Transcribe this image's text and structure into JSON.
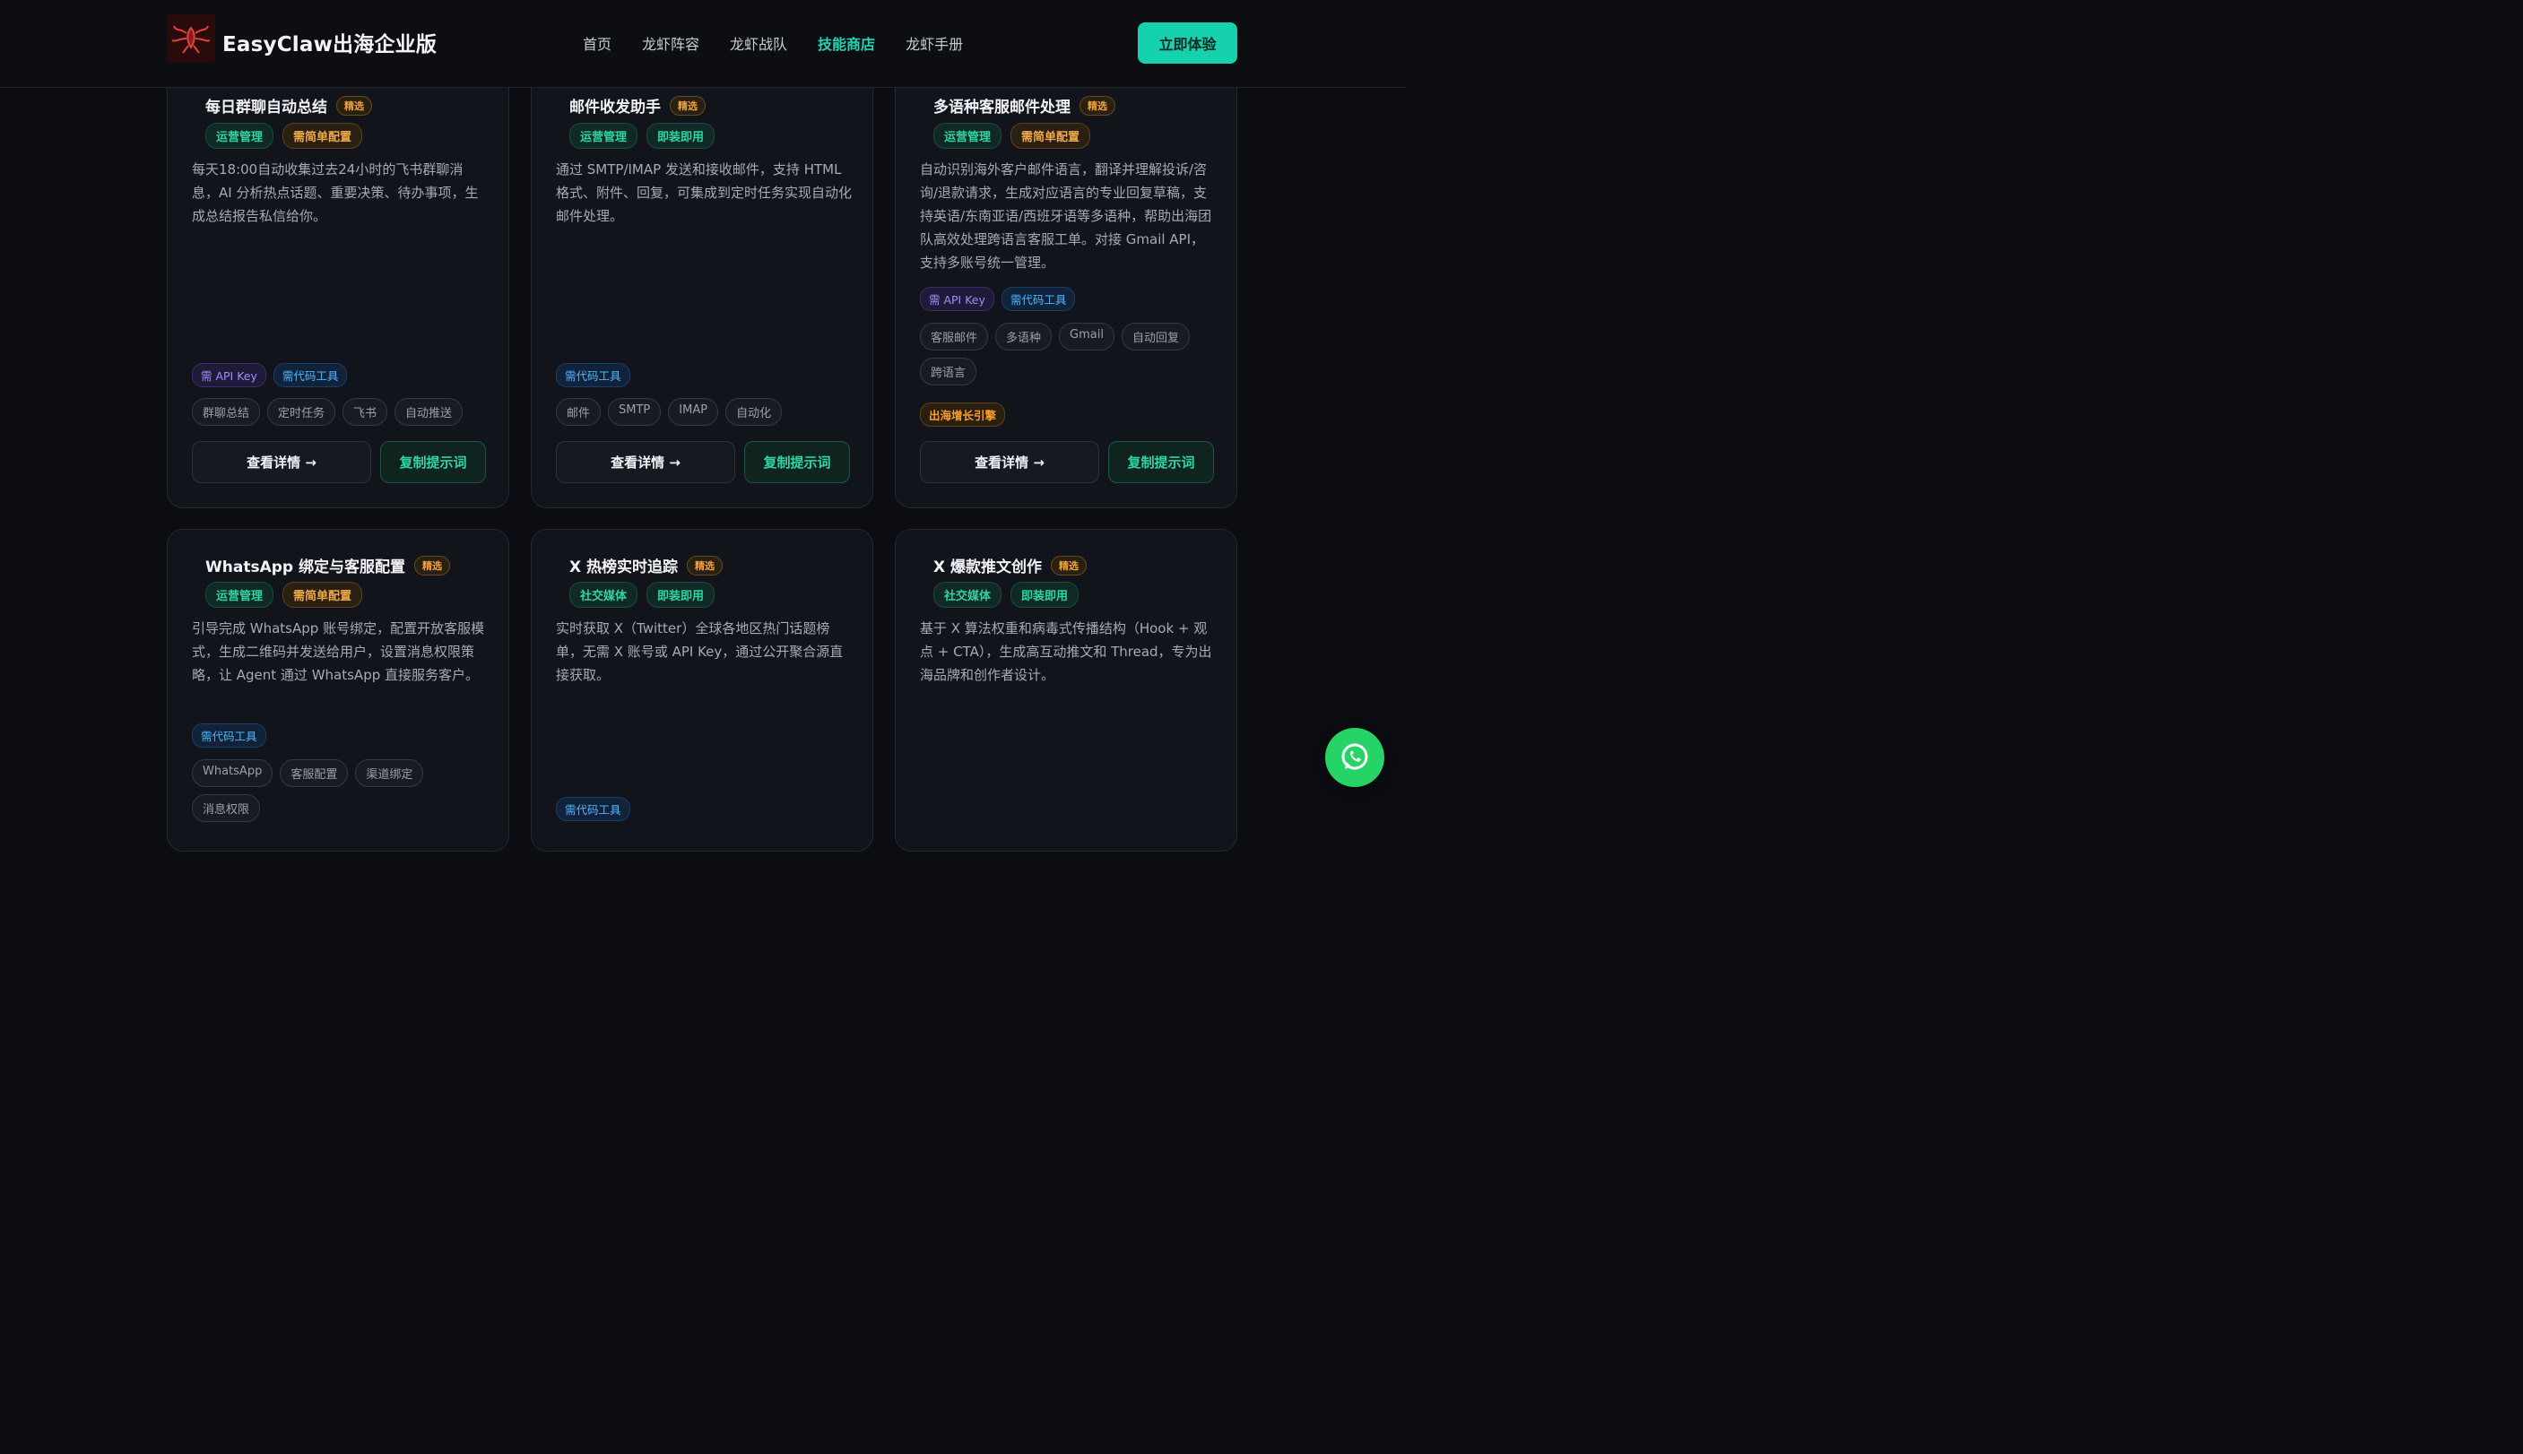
{
  "header": {
    "brand": "EasyClaw出海企业版",
    "nav": [
      "首页",
      "龙虾阵容",
      "龙虾战队",
      "技能商店",
      "龙虾手册"
    ],
    "active_nav": "技能商店",
    "cta": "立即体验"
  },
  "colors": {
    "accent": "#16d1ad",
    "background": "#0b0d12",
    "card": "#12141c",
    "pick_badge": "#f2a23b",
    "whatsapp": "#25d366"
  },
  "cards": [
    {
      "title": "每日群聊自动总结",
      "badge": "精选",
      "tags": [
        {
          "text": "运营管理",
          "style": "green"
        },
        {
          "text": "需简单配置",
          "style": "orange"
        }
      ],
      "desc": "每天18:00自动收集过去24小时的飞书群聊消息，AI 分析热点话题、重要决策、待办事项，生成总结报告私信给你。",
      "requirements": [
        {
          "text": "需 API Key",
          "style": "purple"
        },
        {
          "text": "需代码工具",
          "style": "blue"
        }
      ],
      "keywords": [
        "群聊总结",
        "定时任务",
        "飞书",
        "自动推送"
      ],
      "detail_btn": "查看详情 →",
      "copy_btn": "复制提示词"
    },
    {
      "title": "邮件收发助手",
      "badge": "精选",
      "tags": [
        {
          "text": "运营管理",
          "style": "green"
        },
        {
          "text": "即装即用",
          "style": "green"
        }
      ],
      "desc": "通过 SMTP/IMAP 发送和接收邮件，支持 HTML 格式、附件、回复，可集成到定时任务实现自动化邮件处理。",
      "requirements": [
        {
          "text": "需代码工具",
          "style": "blue"
        }
      ],
      "keywords": [
        "邮件",
        "SMTP",
        "IMAP",
        "自动化"
      ],
      "detail_btn": "查看详情 →",
      "copy_btn": "复制提示词"
    },
    {
      "title": "多语种客服邮件处理",
      "badge": "精选",
      "tags": [
        {
          "text": "运营管理",
          "style": "green"
        },
        {
          "text": "需简单配置",
          "style": "orange"
        }
      ],
      "desc": "自动识别海外客户邮件语言，翻译并理解投诉/咨询/退款请求，生成对应语言的专业回复草稿，支持英语/东南亚语/西班牙语等多语种，帮助出海团队高效处理跨语言客服工单。对接 Gmail API，支持多账号统一管理。",
      "requirements": [
        {
          "text": "需 API Key",
          "style": "purple"
        },
        {
          "text": "需代码工具",
          "style": "blue"
        }
      ],
      "keywords": [
        "客服邮件",
        "多语种",
        "Gmail",
        "自动回复",
        "跨语言"
      ],
      "special_tag": "出海增长引擎",
      "detail_btn": "查看详情 →",
      "copy_btn": "复制提示词"
    },
    {
      "title": "WhatsApp 绑定与客服配置",
      "badge": "精选",
      "tags": [
        {
          "text": "运营管理",
          "style": "green"
        },
        {
          "text": "需简单配置",
          "style": "orange"
        }
      ],
      "desc": "引导完成 WhatsApp 账号绑定，配置开放客服模式，生成二维码并发送给用户，设置消息权限策略，让 Agent 通过 WhatsApp 直接服务客户。",
      "requirements": [
        {
          "text": "需代码工具",
          "style": "blue"
        }
      ],
      "keywords": [
        "WhatsApp",
        "客服配置",
        "渠道绑定",
        "消息权限"
      ]
    },
    {
      "title": "X 热榜实时追踪",
      "badge": "精选",
      "tags": [
        {
          "text": "社交媒体",
          "style": "green"
        },
        {
          "text": "即装即用",
          "style": "green"
        }
      ],
      "desc": "实时获取 X（Twitter）全球各地区热门话题榜单，无需 X 账号或 API Key，通过公开聚合源直接获取。",
      "requirements": [
        {
          "text": "需代码工具",
          "style": "blue"
        }
      ]
    },
    {
      "title": "X 爆款推文创作",
      "badge": "精选",
      "tags": [
        {
          "text": "社交媒体",
          "style": "green"
        },
        {
          "text": "即装即用",
          "style": "green"
        }
      ],
      "desc": "基于 X 算法权重和病毒式传播结构（Hook + 观点 + CTA），生成高互动推文和 Thread，专为出海品牌和创作者设计。"
    }
  ]
}
